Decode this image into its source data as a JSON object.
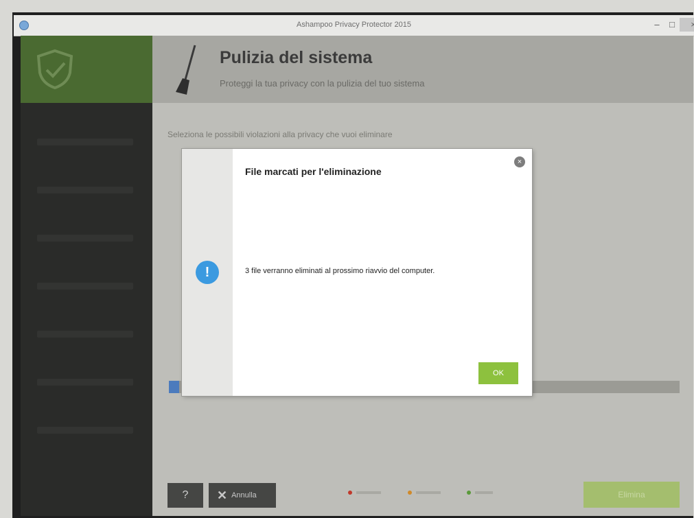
{
  "window": {
    "title": "Ashampoo Privacy Protector 2015",
    "minimize_glyph": "–",
    "maximize_glyph": "□",
    "close_glyph": "×"
  },
  "header": {
    "title": "Pulizia del sistema",
    "subtitle": "Proteggi la tua privacy con la pulizia del tuo sistema"
  },
  "main": {
    "select_hint": "Seleziona le possibili violazioni alla privacy che vuoi eliminare",
    "progress_percent": 2
  },
  "footer": {
    "help_label": "?",
    "cancel_label": "Annulla",
    "clean_label": "Elimina"
  },
  "dialog": {
    "title": "File marcati per l'eliminazione",
    "message": "3 file verranno eliminati al prossimo riavvio del computer.",
    "ok_label": "OK",
    "close_glyph": "×",
    "info_glyph": "!"
  },
  "colors": {
    "sidebar_header": "#4a6a31",
    "accent_green": "#8dc13e",
    "info_blue": "#3b9ae0",
    "progress_blue": "#4c7bbd"
  }
}
